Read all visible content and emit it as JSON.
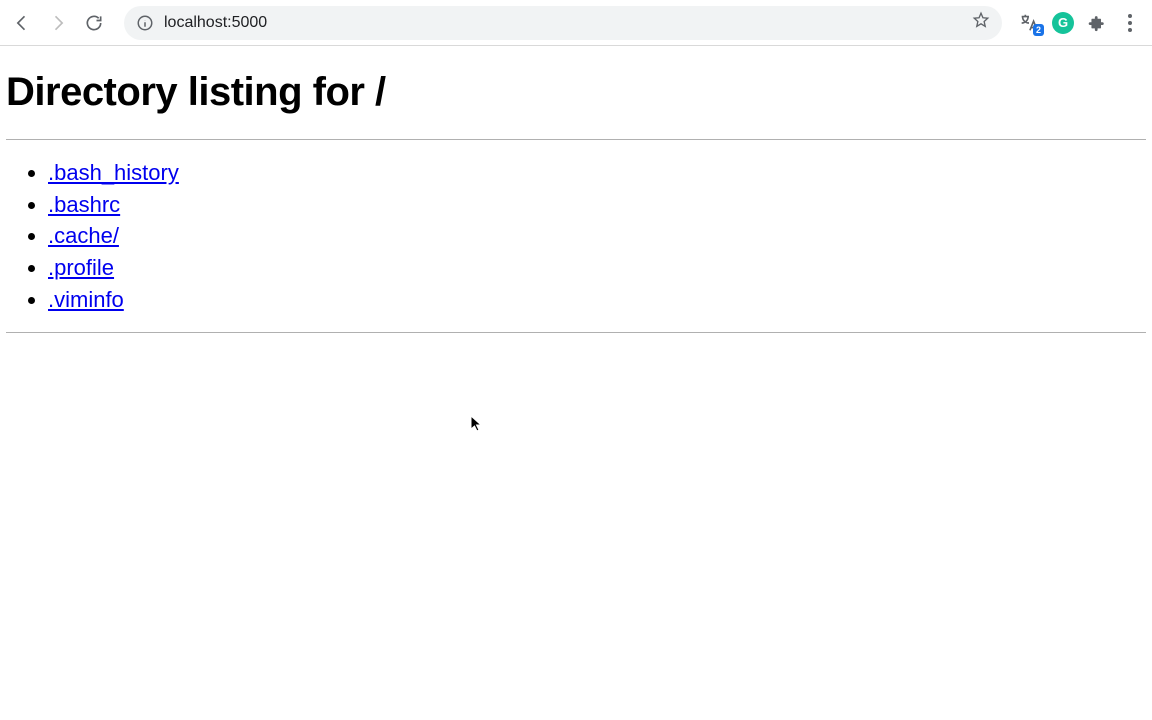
{
  "browser": {
    "url": "localhost:5000",
    "translate_badge": "2",
    "grammarly_initial": "G"
  },
  "page": {
    "title": "Directory listing for /",
    "entries": [
      {
        "label": ".bash_history"
      },
      {
        "label": ".bashrc"
      },
      {
        "label": ".cache/"
      },
      {
        "label": ".profile"
      },
      {
        "label": ".viminfo"
      }
    ]
  }
}
